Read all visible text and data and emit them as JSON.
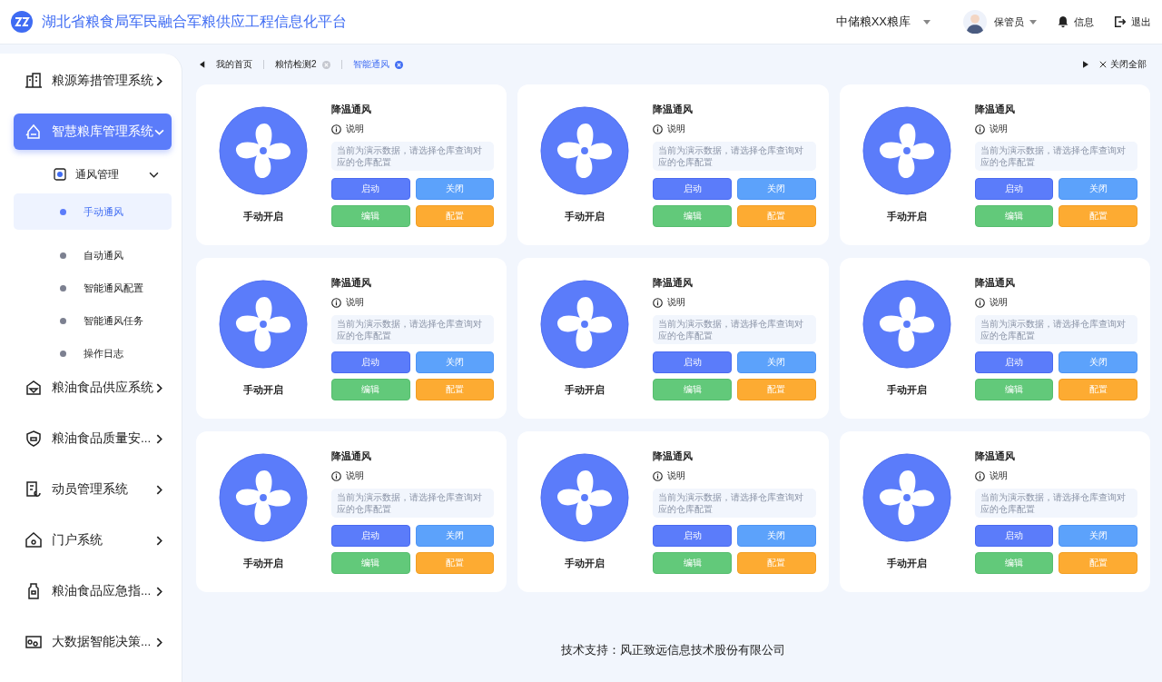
{
  "header": {
    "title": "湖北省粮食局军民融合军粮供应工程信息化平台",
    "warehouse": "中储粮XX粮库",
    "user": "保管员",
    "messages": "信息",
    "logout": "退出"
  },
  "sidebar": {
    "items": [
      {
        "label": "粮源筹措管理系统",
        "expanded": false,
        "selected": false
      },
      {
        "label": "智慧粮库管理系统",
        "expanded": true,
        "selected": true,
        "children": [
          {
            "label": "通风管理",
            "expanded": true,
            "children": [
              {
                "label": "手动通风",
                "selected": true
              },
              {
                "label": "自动通风",
                "selected": false
              },
              {
                "label": "智能通风配置",
                "selected": false
              },
              {
                "label": "智能通风任务",
                "selected": false
              },
              {
                "label": "操作日志",
                "selected": false
              }
            ]
          }
        ]
      },
      {
        "label": "粮油食品供应系统",
        "expanded": false,
        "selected": false
      },
      {
        "label": "粮油食品质量安...",
        "expanded": false,
        "selected": false
      },
      {
        "label": "动员管理系统",
        "expanded": false,
        "selected": false
      },
      {
        "label": "门户系统",
        "expanded": false,
        "selected": false
      },
      {
        "label": "粮油食品应急指...",
        "expanded": false,
        "selected": false
      },
      {
        "label": "大数据智能决策...",
        "expanded": false,
        "selected": false
      }
    ]
  },
  "tabs": [
    {
      "label": "我的首页",
      "selected": false,
      "closable": false
    },
    {
      "label": "粮情检测2",
      "selected": false,
      "closable": true
    },
    {
      "label": "智能通风",
      "selected": true,
      "closable": true
    }
  ],
  "close_all": "关闭全部",
  "cards": [
    {
      "title": "降温通风",
      "info": "说明",
      "note": "当前为演示数据，请选择仓库查询对应的仓库配置",
      "status": "手动开启",
      "buttons": [
        {
          "label": "启动",
          "kind": "start"
        },
        {
          "label": "关闭",
          "kind": "stop"
        },
        {
          "label": "编辑",
          "kind": "edit"
        },
        {
          "label": "配置",
          "kind": "config"
        }
      ]
    },
    {
      "title": "降温通风",
      "info": "说明",
      "note": "当前为演示数据，请选择仓库查询对应的仓库配置",
      "status": "手动开启",
      "buttons": [
        {
          "label": "启动",
          "kind": "start"
        },
        {
          "label": "关闭",
          "kind": "stop"
        },
        {
          "label": "编辑",
          "kind": "edit"
        },
        {
          "label": "配置",
          "kind": "config"
        }
      ]
    },
    {
      "title": "降温通风",
      "info": "说明",
      "note": "当前为演示数据，请选择仓库查询对应的仓库配置",
      "status": "手动开启",
      "buttons": [
        {
          "label": "启动",
          "kind": "start"
        },
        {
          "label": "关闭",
          "kind": "stop"
        },
        {
          "label": "编辑",
          "kind": "edit"
        },
        {
          "label": "配置",
          "kind": "config"
        }
      ]
    },
    {
      "title": "降温通风",
      "info": "说明",
      "note": "当前为演示数据，请选择仓库查询对应的仓库配置",
      "status": "手动开启",
      "buttons": [
        {
          "label": "启动",
          "kind": "start"
        },
        {
          "label": "关闭",
          "kind": "stop"
        },
        {
          "label": "编辑",
          "kind": "edit"
        },
        {
          "label": "配置",
          "kind": "config"
        }
      ]
    },
    {
      "title": "降温通风",
      "info": "说明",
      "note": "当前为演示数据，请选择仓库查询对应的仓库配置",
      "status": "手动开启",
      "buttons": [
        {
          "label": "启动",
          "kind": "start"
        },
        {
          "label": "关闭",
          "kind": "stop"
        },
        {
          "label": "编辑",
          "kind": "edit"
        },
        {
          "label": "配置",
          "kind": "config"
        }
      ]
    },
    {
      "title": "降温通风",
      "info": "说明",
      "note": "当前为演示数据，请选择仓库查询对应的仓库配置",
      "status": "手动开启",
      "buttons": [
        {
          "label": "启动",
          "kind": "start"
        },
        {
          "label": "关闭",
          "kind": "stop"
        },
        {
          "label": "编辑",
          "kind": "edit"
        },
        {
          "label": "配置",
          "kind": "config"
        }
      ]
    },
    {
      "title": "降温通风",
      "info": "说明",
      "note": "当前为演示数据，请选择仓库查询对应的仓库配置",
      "status": "手动开启",
      "buttons": [
        {
          "label": "启动",
          "kind": "start"
        },
        {
          "label": "关闭",
          "kind": "stop"
        },
        {
          "label": "编辑",
          "kind": "edit"
        },
        {
          "label": "配置",
          "kind": "config"
        }
      ]
    },
    {
      "title": "降温通风",
      "info": "说明",
      "note": "当前为演示数据，请选择仓库查询对应的仓库配置",
      "status": "手动开启",
      "buttons": [
        {
          "label": "启动",
          "kind": "start"
        },
        {
          "label": "关闭",
          "kind": "stop"
        },
        {
          "label": "编辑",
          "kind": "edit"
        },
        {
          "label": "配置",
          "kind": "config"
        }
      ]
    },
    {
      "title": "降温通风",
      "info": "说明",
      "note": "当前为演示数据，请选择仓库查询对应的仓库配置",
      "status": "手动开启",
      "buttons": [
        {
          "label": "启动",
          "kind": "start"
        },
        {
          "label": "关闭",
          "kind": "stop"
        },
        {
          "label": "编辑",
          "kind": "edit"
        },
        {
          "label": "配置",
          "kind": "config"
        }
      ]
    }
  ],
  "footer": "技术支持：风正致远信息技术股份有限公司"
}
